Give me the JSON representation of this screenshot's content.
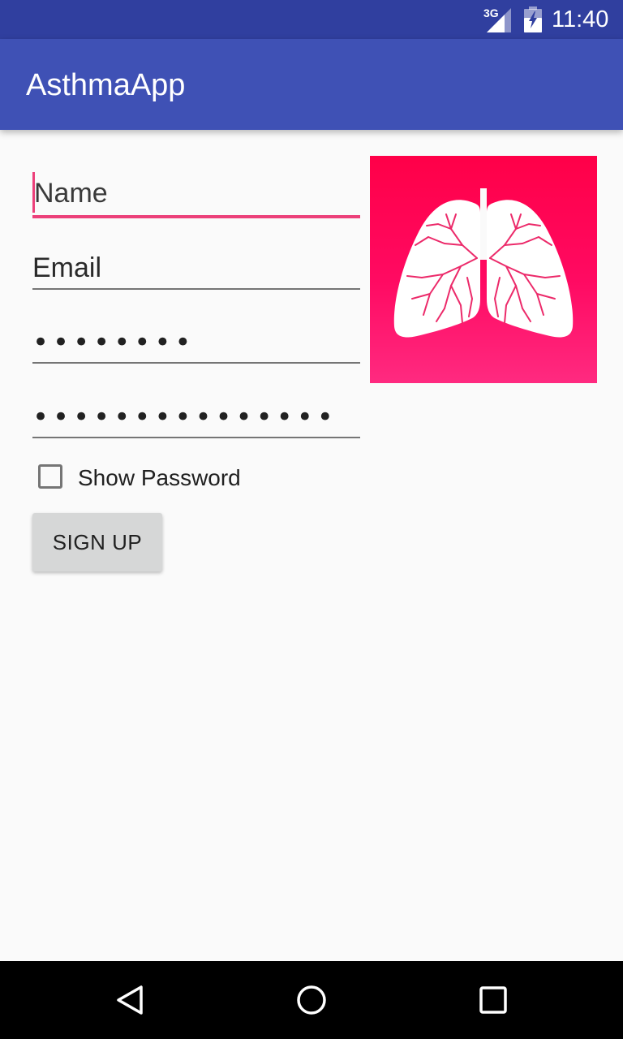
{
  "status_bar": {
    "network_type": "3G",
    "time": "11:40",
    "icons": [
      "signal-icon",
      "battery-icon"
    ],
    "background_color": "#303f9f"
  },
  "app_bar": {
    "title": "AsthmaApp",
    "background_color": "#3f51b5"
  },
  "form": {
    "name": {
      "placeholder": "Name",
      "focused": true
    },
    "email": {
      "placeholder": "Email"
    },
    "password": {
      "masked_value": "••••••••"
    },
    "confirm_password": {
      "masked_value": "•••••••••••••••"
    },
    "show_password": {
      "label": "Show Password",
      "checked": false
    },
    "submit": {
      "label": "SIGN UP"
    },
    "accent_color": "#ec407a"
  },
  "logo": {
    "icon": "lungs-icon",
    "background_color": "#ff0a62"
  },
  "nav_bar": {
    "icons": [
      "back-icon",
      "home-icon",
      "recents-icon"
    ]
  }
}
